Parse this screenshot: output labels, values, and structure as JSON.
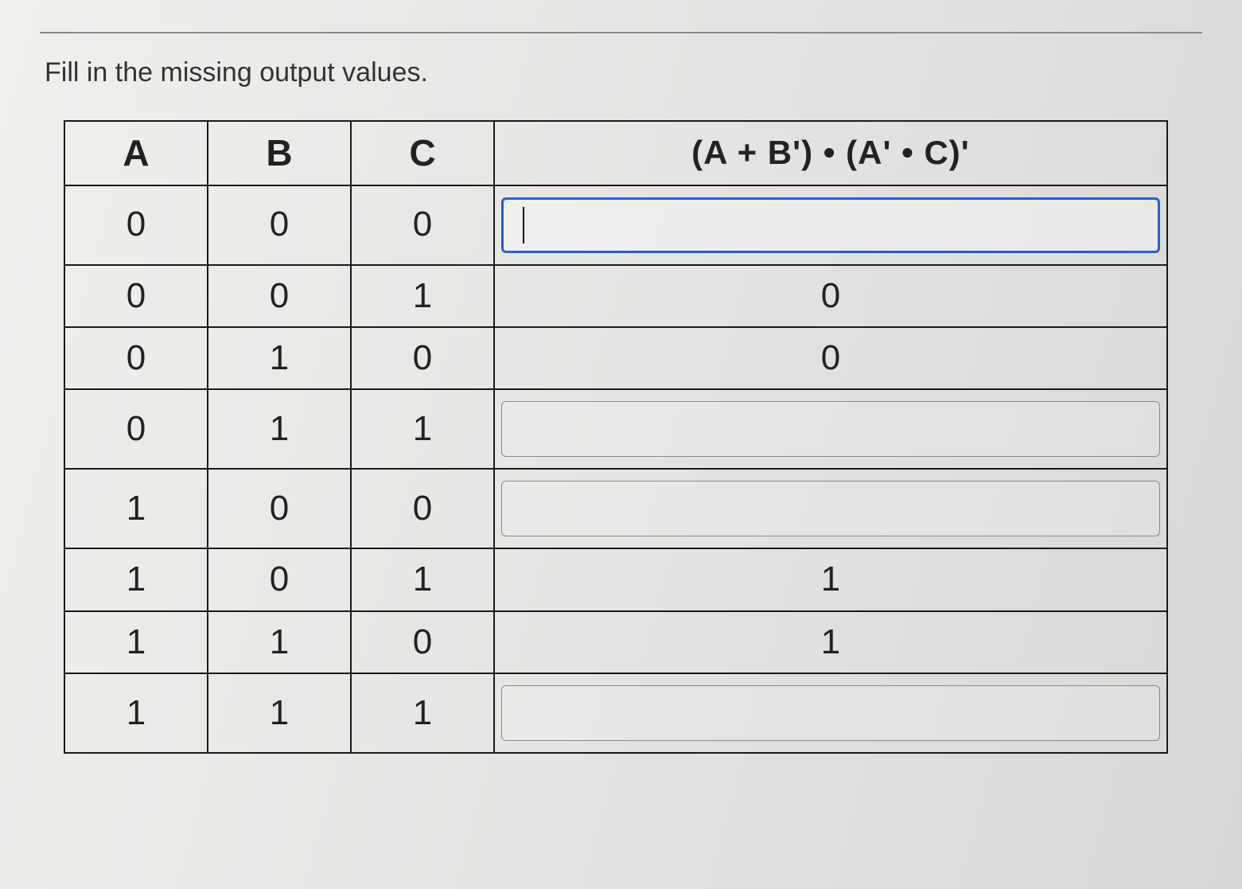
{
  "instruction": "Fill in the missing output values.",
  "headers": {
    "a": "A",
    "b": "B",
    "c": "C",
    "out": "(A + B') • (A' • C)'"
  },
  "rows": [
    {
      "a": "0",
      "b": "0",
      "c": "0",
      "out_type": "input",
      "out_value": "",
      "active": true
    },
    {
      "a": "0",
      "b": "0",
      "c": "1",
      "out_type": "static",
      "out_value": "0",
      "active": false
    },
    {
      "a": "0",
      "b": "1",
      "c": "0",
      "out_type": "static",
      "out_value": "0",
      "active": false
    },
    {
      "a": "0",
      "b": "1",
      "c": "1",
      "out_type": "input",
      "out_value": "",
      "active": false
    },
    {
      "a": "1",
      "b": "0",
      "c": "0",
      "out_type": "input",
      "out_value": "",
      "active": false
    },
    {
      "a": "1",
      "b": "0",
      "c": "1",
      "out_type": "static",
      "out_value": "1",
      "active": false
    },
    {
      "a": "1",
      "b": "1",
      "c": "0",
      "out_type": "static",
      "out_value": "1",
      "active": false
    },
    {
      "a": "1",
      "b": "1",
      "c": "1",
      "out_type": "input",
      "out_value": "",
      "active": false
    }
  ]
}
